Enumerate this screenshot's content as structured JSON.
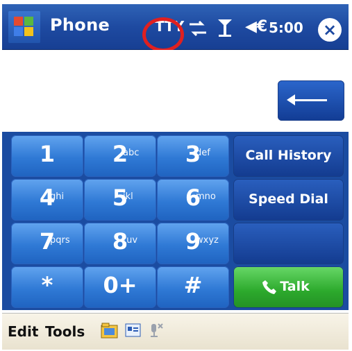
{
  "title_bar": {
    "app_title": "Phone",
    "tty": "TTY",
    "volume": "◀€",
    "time": "5:00",
    "close": "×"
  },
  "keys": [
    {
      "main": "1",
      "letters": ""
    },
    {
      "main": "2",
      "letters": "abc"
    },
    {
      "main": "3",
      "letters": "def"
    },
    {
      "main": "4",
      "letters": "ghi"
    },
    {
      "main": "5",
      "letters": "jkl"
    },
    {
      "main": "6",
      "letters": "mno"
    },
    {
      "main": "7",
      "letters": "pqrs"
    },
    {
      "main": "8",
      "letters": "tuv"
    },
    {
      "main": "9",
      "letters": "wxyz"
    },
    {
      "main": "*",
      "letters": ""
    },
    {
      "main": "0+",
      "letters": ""
    },
    {
      "main": "#",
      "letters": ""
    }
  ],
  "function_keys": {
    "call_history": "Call History",
    "speed_dial": "Speed Dial",
    "talk": "Talk"
  },
  "menu": {
    "edit": "Edit",
    "tools": "Tools"
  },
  "colors": {
    "title_bar": "#1e4aa1",
    "key_blue": "#2f79d5",
    "talk_green": "#2ca92c",
    "tty_ring": "#e02020"
  }
}
